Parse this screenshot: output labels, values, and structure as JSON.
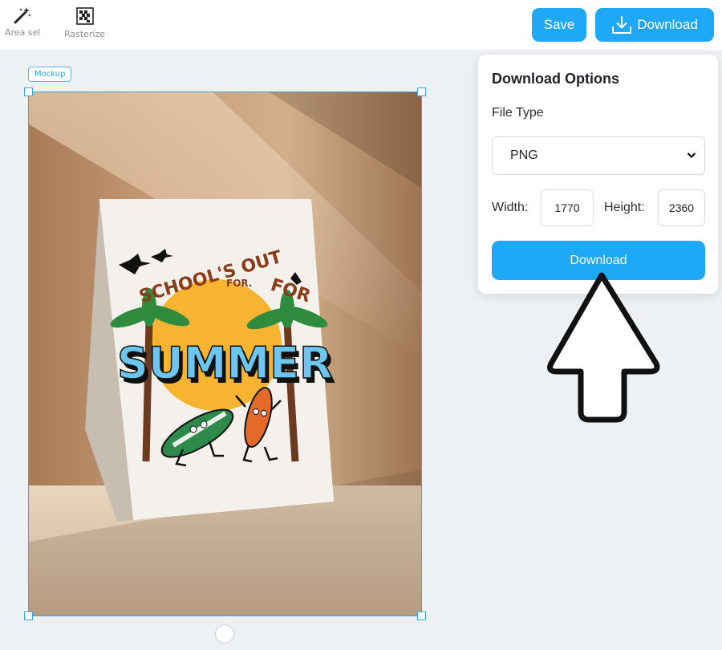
{
  "toolbar": {
    "area_select_label": "Area sel",
    "rasterize_label": "Rasterize",
    "save_label": "Save",
    "download_label": "Download",
    "download_icon": "download-tray-icon"
  },
  "canvas": {
    "layer_tag": "Mockup",
    "card": {
      "headline_top": "SCHOOL'S OUT",
      "headline_mid": "FOR.",
      "headline_right": "FOR",
      "headline_main": "SUMMER"
    }
  },
  "download_panel": {
    "title": "Download Options",
    "file_type_label": "File Type",
    "file_type_value": "PNG",
    "width_label": "Width:",
    "width_value": "1770",
    "height_label": "Height:",
    "height_value": "2360",
    "download_button": "Download"
  },
  "colors": {
    "accent": "#1ea8f5",
    "selection": "#3fa6e6"
  }
}
